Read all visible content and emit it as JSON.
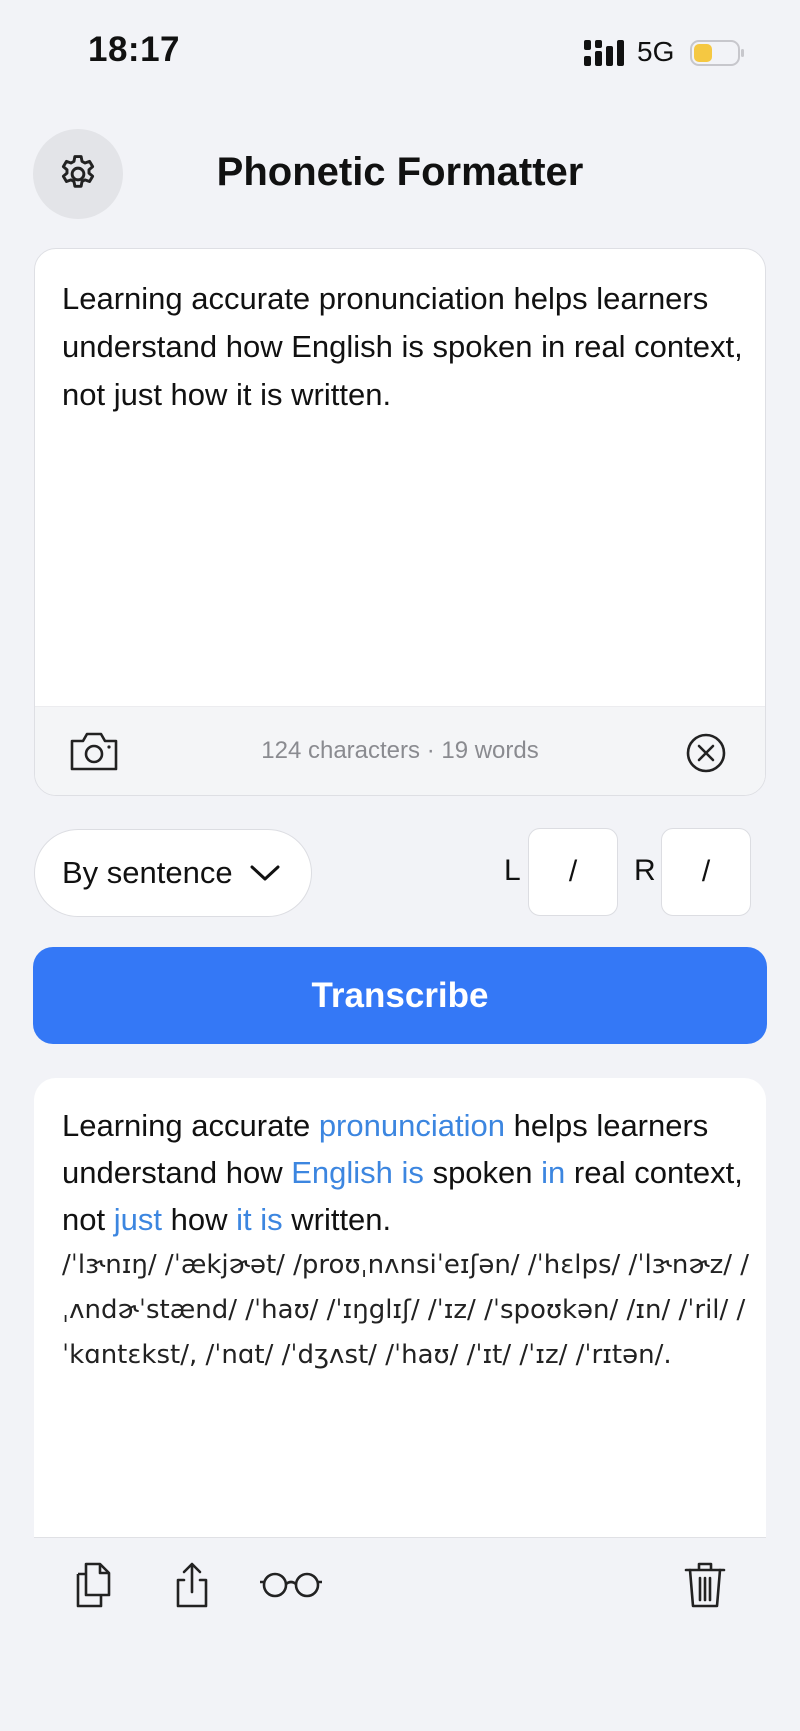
{
  "status_bar": {
    "time": "18:17",
    "network": "5G"
  },
  "header": {
    "title": "Phonetic Formatter"
  },
  "input": {
    "text": "Learning accurate pronunciation helps learners understand how English is spoken in real context, not just how it is written.",
    "counter": "124 characters · 19 words"
  },
  "options": {
    "split_mode": "By sentence",
    "left_label": "L",
    "left_delimiter": "/",
    "right_label": "R",
    "right_delimiter": "/"
  },
  "transcribe_label": "Transcribe",
  "result": {
    "words": [
      {
        "t": "Learning"
      },
      {
        "t": " "
      },
      {
        "t": "accurate"
      },
      {
        "t": " "
      },
      {
        "t": "pronunciation",
        "hl": true
      },
      {
        "t": " "
      },
      {
        "t": "helps"
      },
      {
        "t": " "
      },
      {
        "t": "learners"
      },
      {
        "t": " "
      },
      {
        "t": "understand"
      },
      {
        "t": " "
      },
      {
        "t": "how"
      },
      {
        "t": " "
      },
      {
        "t": "English is",
        "hl": true
      },
      {
        "t": " "
      },
      {
        "t": "spoken"
      },
      {
        "t": " "
      },
      {
        "t": "in",
        "hl": true
      },
      {
        "t": " "
      },
      {
        "t": "real"
      },
      {
        "t": " "
      },
      {
        "t": "context,"
      },
      {
        "t": " "
      },
      {
        "t": "not"
      },
      {
        "t": " "
      },
      {
        "t": "just",
        "hl": true
      },
      {
        "t": " "
      },
      {
        "t": "how"
      },
      {
        "t": " "
      },
      {
        "t": "it is",
        "hl": true
      },
      {
        "t": " "
      },
      {
        "t": "written."
      }
    ],
    "ipa": "/ˈlɝnɪŋ/ /ˈækjɚət/ /proʊˌnʌnsiˈeɪʃən/ /ˈhɛlps/ /ˈlɝnɚz/ /ˌʌndɚˈstænd/ /ˈhaʊ/ /ˈɪŋglɪʃ/ /ˈɪz/ /ˈspoʊkən/ /ɪn/ /ˈril/ /ˈkɑntɛkst/, /ˈnɑt/ /ˈdʒʌst/ /ˈhaʊ/ /ˈɪt/ /ˈɪz/ /ˈrɪtən/."
  },
  "icons": {
    "settings": "gear-icon",
    "camera": "camera-icon",
    "clear": "clear-circle-x-icon",
    "dropdown": "chevron-down-icon",
    "copy": "copy-documents-icon",
    "share": "share-icon",
    "reader": "glasses-icon",
    "delete": "trash-icon"
  },
  "colors": {
    "accent": "#3478f6",
    "highlight": "#3c86e0",
    "battery": "#f5c842",
    "background": "#f2f3f7"
  }
}
